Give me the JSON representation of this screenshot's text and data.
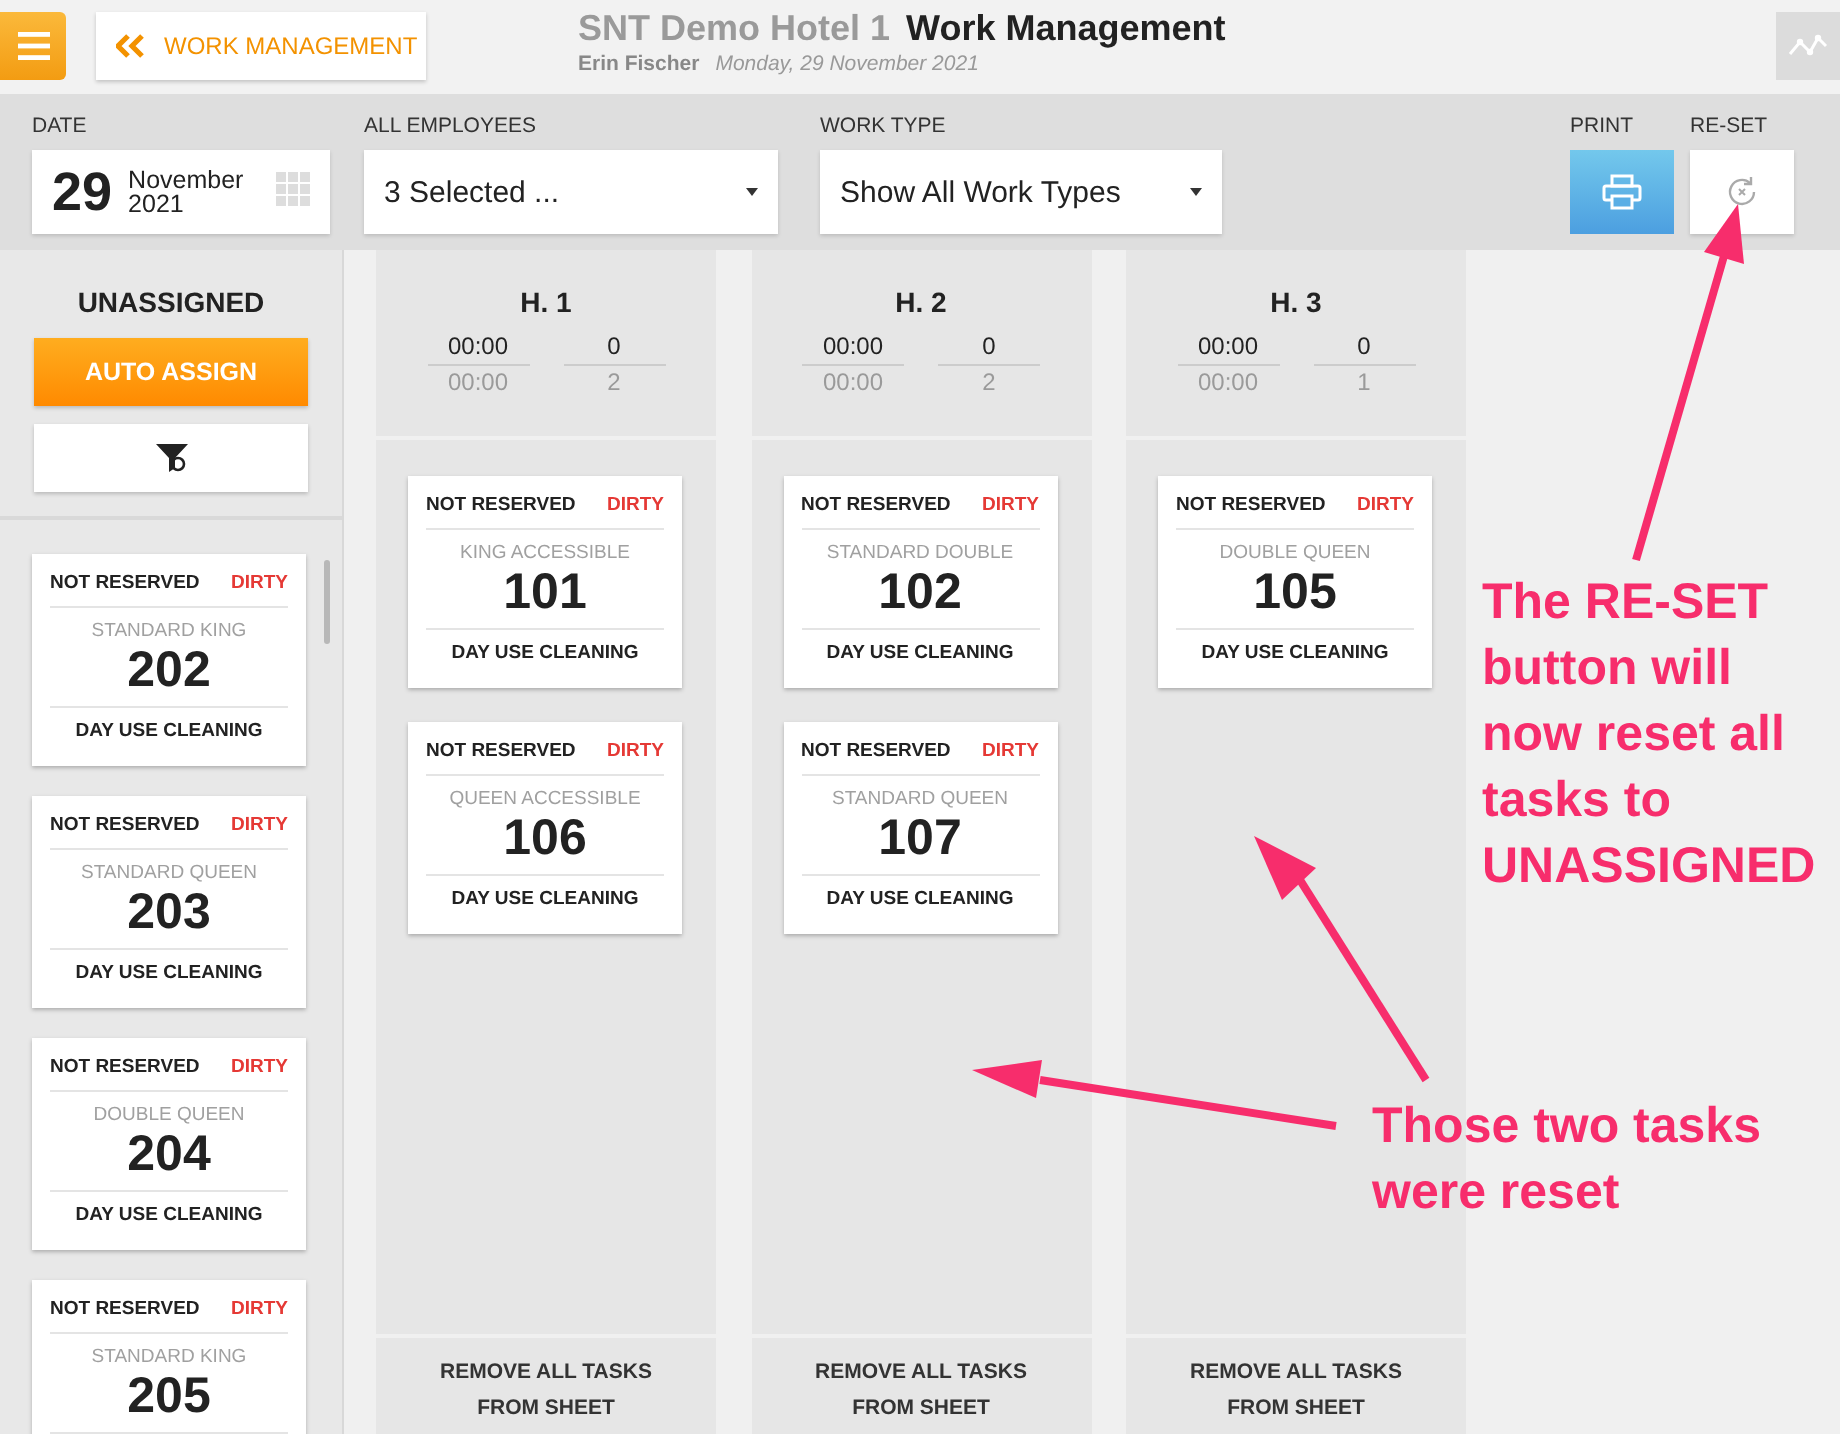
{
  "header": {
    "back_button": "WORK MANAGEMENT",
    "hotel": "SNT Demo Hotel 1",
    "title": "Work Management",
    "user": "Erin Fischer",
    "date": "Monday, 29 November 2021"
  },
  "filters": {
    "date": {
      "label": "DATE",
      "day": "29",
      "month": "November",
      "year": "2021"
    },
    "employees": {
      "label": "ALL EMPLOYEES",
      "value": "3 Selected ..."
    },
    "work_type": {
      "label": "WORK TYPE",
      "value": "Show All Work Types"
    },
    "print": {
      "label": "PRINT"
    },
    "reset": {
      "label": "RE-SET"
    }
  },
  "unassigned": {
    "title": "UNASSIGNED",
    "auto_assign": "AUTO ASSIGN",
    "tasks": [
      {
        "reservation": "NOT RESERVED",
        "status": "DIRTY",
        "room_type": "STANDARD KING",
        "room": "202",
        "task": "DAY USE CLEANING"
      },
      {
        "reservation": "NOT RESERVED",
        "status": "DIRTY",
        "room_type": "STANDARD QUEEN",
        "room": "203",
        "task": "DAY USE CLEANING"
      },
      {
        "reservation": "NOT RESERVED",
        "status": "DIRTY",
        "room_type": "DOUBLE QUEEN",
        "room": "204",
        "task": "DAY USE CLEANING"
      },
      {
        "reservation": "NOT RESERVED",
        "status": "DIRTY",
        "room_type": "STANDARD KING",
        "room": "205"
      }
    ]
  },
  "columns": [
    {
      "name": "H. 1",
      "time": "00:00",
      "time_total": "00:00",
      "count": "0",
      "count_total": "2",
      "footer": "REMOVE ALL TASKS FROM SHEET",
      "tasks": [
        {
          "reservation": "NOT RESERVED",
          "status": "DIRTY",
          "room_type": "KING ACCESSIBLE",
          "room": "101",
          "task": "DAY USE CLEANING"
        },
        {
          "reservation": "NOT RESERVED",
          "status": "DIRTY",
          "room_type": "QUEEN ACCESSIBLE",
          "room": "106",
          "task": "DAY USE CLEANING"
        }
      ]
    },
    {
      "name": "H. 2",
      "time": "00:00",
      "time_total": "00:00",
      "count": "0",
      "count_total": "2",
      "footer": "REMOVE ALL TASKS FROM SHEET",
      "tasks": [
        {
          "reservation": "NOT RESERVED",
          "status": "DIRTY",
          "room_type": "STANDARD DOUBLE",
          "room": "102",
          "task": "DAY USE CLEANING"
        },
        {
          "reservation": "NOT RESERVED",
          "status": "DIRTY",
          "room_type": "STANDARD QUEEN",
          "room": "107",
          "task": "DAY USE CLEANING"
        }
      ]
    },
    {
      "name": "H. 3",
      "time": "00:00",
      "time_total": "00:00",
      "count": "0",
      "count_total": "1",
      "footer": "REMOVE ALL TASKS FROM SHEET",
      "tasks": [
        {
          "reservation": "NOT RESERVED",
          "status": "DIRTY",
          "room_type": "DOUBLE QUEEN",
          "room": "105",
          "task": "DAY USE CLEANING"
        }
      ]
    }
  ],
  "annotations": [
    {
      "text": "The RE-SET button will now reset all tasks to UNASSIGNED"
    },
    {
      "text": "Those two tasks were reset"
    }
  ]
}
